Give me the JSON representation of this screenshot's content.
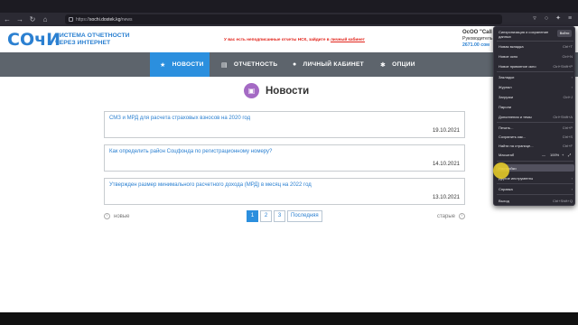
{
  "browser": {
    "url_prefix": "https://",
    "url_domain": "sochi.dostek.kg",
    "url_path": "/news",
    "nav_back": "←",
    "nav_forward": "→",
    "nav_reload": "↻",
    "nav_home": "⌂"
  },
  "site": {
    "logo": "СОчИ",
    "tagline_line1": "СИСТЕМА ОТЧЕТНОСТИ",
    "tagline_line2": "ЧЕРЕЗ ИНТЕРНЕТ",
    "warning_text": "У вас есть неподписанные отчеты НСК, зайдите в",
    "warning_link": "личный кабинет",
    "company_name": "ОсОО \"Call",
    "company_role": "Руководитель",
    "company_balance": "2671.00 сом"
  },
  "nav": {
    "news": "НОВОСТИ",
    "reports": "ОТЧЕТНОСТЬ",
    "cabinet": "ЛИЧНЫЙ КАБИНЕТ",
    "options": "ОПЦИИ"
  },
  "main": {
    "title": "Новости",
    "news": [
      {
        "title": "СМЗ и МРД для расчета страховых взносов на 2020 год",
        "date": "19.10.2021"
      },
      {
        "title": "Как определить район Соцфонда по регистрационному номеру?",
        "date": "14.10.2021"
      },
      {
        "title": "Утвержден размер минимального расчетного дохода (МРД) в месяц на 2022 год",
        "date": "13.10.2021"
      }
    ],
    "pager": {
      "newer": "новые",
      "older": "старые",
      "pages": [
        "1",
        "2",
        "3"
      ],
      "last": "Последняя"
    }
  },
  "menu": {
    "sync_title": "Синхронизация и сохранение данных",
    "sync_button": "Войти",
    "items": [
      {
        "label": "Новая вкладка",
        "shortcut": "Ctrl+T"
      },
      {
        "label": "Новое окно",
        "shortcut": "Ctrl+N"
      },
      {
        "label": "Новое приватное окно",
        "shortcut": "Ctrl+Shift+P"
      },
      {
        "label": "Закладки",
        "shortcut": "›"
      },
      {
        "label": "Журнал",
        "shortcut": "›"
      },
      {
        "label": "Загрузки",
        "shortcut": "Ctrl+J"
      },
      {
        "label": "Пароли",
        "shortcut": ""
      },
      {
        "label": "Дополнения и темы",
        "shortcut": "Ctrl+Shift+A"
      },
      {
        "label": "Печать...",
        "shortcut": "Ctrl+P"
      },
      {
        "label": "Сохранить как...",
        "shortcut": "Ctrl+S"
      },
      {
        "label": "Найти на странице...",
        "shortcut": "Ctrl+F"
      },
      {
        "label": "Масштаб",
        "shortcut": ""
      },
      {
        "label": "Настройки",
        "shortcut": ""
      },
      {
        "label": "Другие инструменты",
        "shortcut": "›"
      },
      {
        "label": "Справка",
        "shortcut": "›"
      },
      {
        "label": "Выход",
        "shortcut": "Ctrl+Shift+Q"
      }
    ],
    "zoom_minus": "—",
    "zoom_value": "100%",
    "zoom_plus": "+",
    "zoom_full": "⤢"
  },
  "colors": {
    "brand_blue": "#2b80d1",
    "nav_active": "#2b8fde",
    "nav_bg": "#5d646c",
    "warning_red": "#e2231a",
    "title_icon": "#a46ac4"
  }
}
